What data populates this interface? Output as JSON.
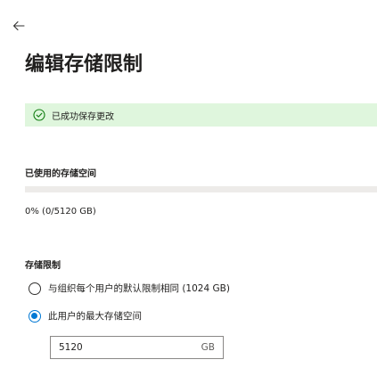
{
  "header": {
    "back_icon": "arrow-left-icon",
    "title": "编辑存储限制"
  },
  "notification": {
    "icon": "checkmark-circle-icon",
    "text": "已成功保存更改",
    "color": "#dff6dd",
    "icon_color": "#107c10"
  },
  "usage": {
    "label": "已使用的存储空间",
    "fraction": 0,
    "text": "0% (0/5120 GB)"
  },
  "limit": {
    "label": "存储限制",
    "options": [
      {
        "label": "与组织每个用户的默认限制相同 (1024 GB)",
        "checked": false
      },
      {
        "label": "此用户的最大存储空间",
        "checked": true
      }
    ],
    "input_value": "5120",
    "input_suffix": "GB"
  },
  "colors": {
    "accent": "#0078d4",
    "success_background": "#dff6dd"
  }
}
